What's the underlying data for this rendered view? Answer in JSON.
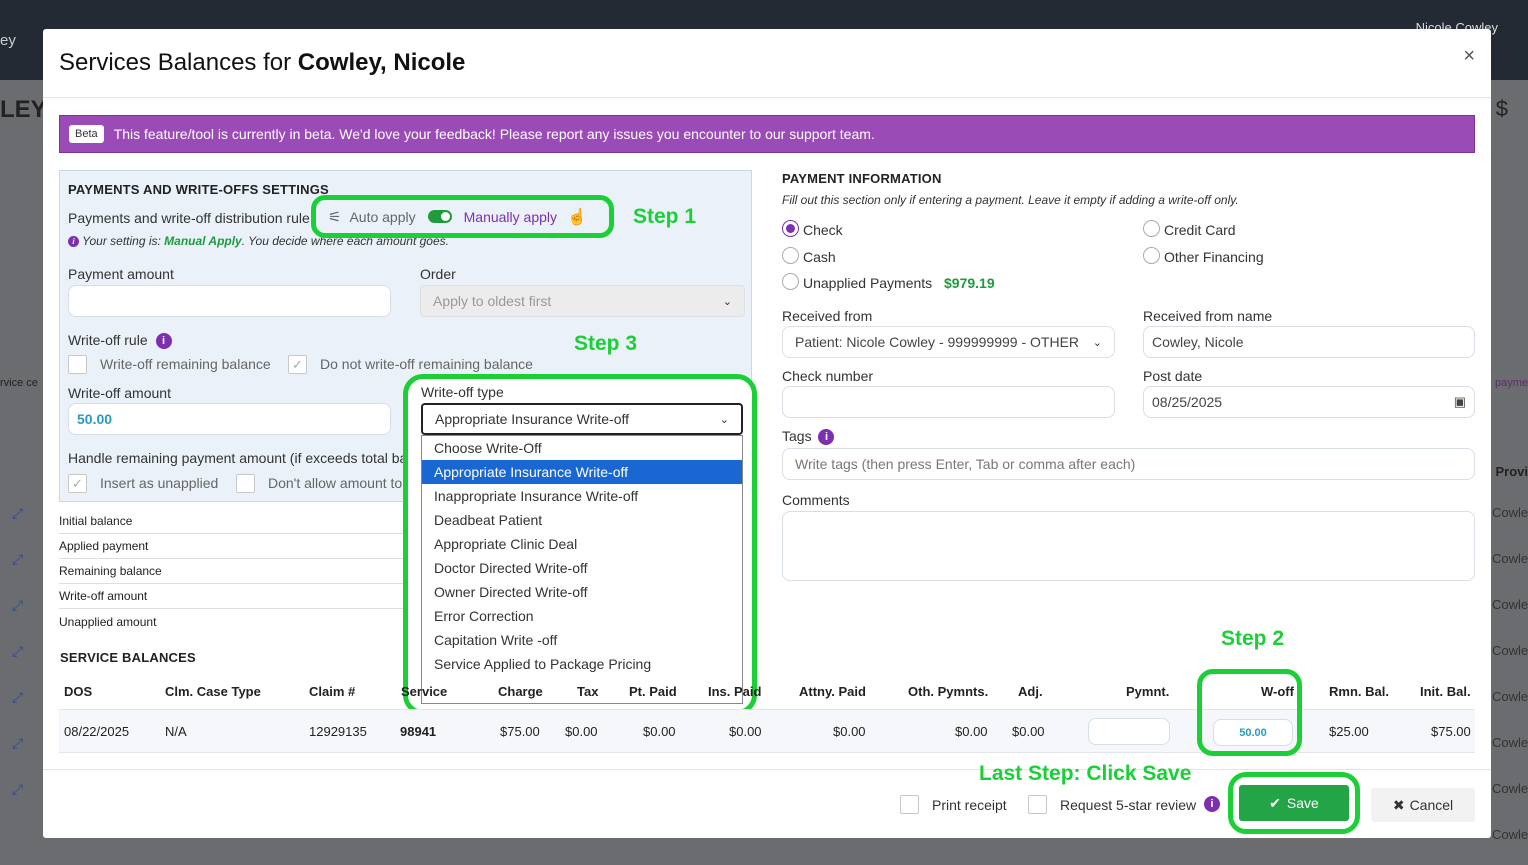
{
  "background": {
    "app_text_left": "ey",
    "user_name": "Nicole Cowley",
    "page_title_fragment": "LEY",
    "left_fragment": "rvice ce",
    "right_fragment": "payme",
    "provider_header": "Provi",
    "provider_rows": [
      "Cowle",
      "Cowle",
      "Cowle",
      "Cowle",
      "Cowle",
      "Cowle",
      "Cowle",
      "Cowle"
    ]
  },
  "modal": {
    "title_prefix": "Services Balances for ",
    "title_name": "Cowley, Nicole",
    "close": "×"
  },
  "beta": {
    "tag": "Beta",
    "message": "This feature/tool is currently in beta. We'd love your feedback! Please report any issues you encounter to our support team."
  },
  "settings": {
    "title": "PAYMENTS AND WRITE-OFFS SETTINGS",
    "distribution_label": "Payments and write-off distribution rule",
    "auto_apply": "Auto apply",
    "manual_apply": "Manually apply",
    "setting_note_prefix": "Your setting is: ",
    "setting_note_value": "Manual Apply",
    "setting_note_suffix": ". You decide where each amount goes.",
    "payment_amount_label": "Payment amount",
    "payment_amount_value": "",
    "order_label": "Order",
    "order_value": "Apply to oldest first",
    "writeoff_rule_label": "Write-off rule",
    "writeoff_remaining": "Write-off remaining balance",
    "no_writeoff_remaining": "Do not write-off remaining balance",
    "writeoff_amount_label": "Write-off amount",
    "writeoff_amount_value": "50.00",
    "writeoff_type_label": "Write-off type",
    "writeoff_type_value": "Appropriate Insurance Write-off",
    "handle_remaining_label": "Handle remaining payment amount (if exceeds total balance)",
    "insert_unapplied": "Insert as unapplied",
    "dont_allow": "Don't allow amount to exceed"
  },
  "writeoff_options": [
    "Choose Write-Off",
    "Appropriate Insurance Write-off",
    "Inappropriate Insurance Write-off",
    "Deadbeat Patient",
    "Appropriate Clinic Deal",
    "Doctor Directed Write-off",
    "Owner Directed Write-off",
    "Error Correction",
    "Capitation Write -off",
    "Service Applied to Package Pricing"
  ],
  "summary": {
    "rows": [
      "Initial balance",
      "Applied payment",
      "Remaining balance",
      "Write-off amount",
      "Unapplied amount"
    ]
  },
  "steps": {
    "step1": "Step 1",
    "step2": "Step 2",
    "step3": "Step 3",
    "last": "Last Step: Click Save"
  },
  "payment": {
    "title": "PAYMENT INFORMATION",
    "note": "Fill out this section only if entering a payment. Leave it empty if adding a write-off only.",
    "methods": {
      "check": "Check",
      "credit_card": "Credit Card",
      "cash": "Cash",
      "other_financing": "Other Financing",
      "unapplied": "Unapplied Payments",
      "unapplied_amount": "$979.19"
    },
    "received_from_label": "Received from",
    "received_from_value": "Patient: Nicole Cowley - 999999999 - OTHER",
    "received_from_name_label": "Received from name",
    "received_from_name_value": "Cowley, Nicole",
    "check_number_label": "Check number",
    "post_date_label": "Post date",
    "post_date_value": "08/25/2025",
    "tags_label": "Tags",
    "tags_placeholder": "Write tags (then press Enter, Tab or comma after each)",
    "comments_label": "Comments"
  },
  "service_balances": {
    "title": "SERVICE BALANCES",
    "columns": [
      "DOS",
      "Clm. Case Type",
      "Claim #",
      "Service",
      "Charge",
      "Tax",
      "Pt. Paid",
      "Ins. Paid",
      "Attny. Paid",
      "Oth. Pymnts.",
      "Adj.",
      "Pymnt.",
      "W-off",
      "Rmn. Bal.",
      "Init. Bal."
    ],
    "row": {
      "dos": "08/22/2025",
      "case_type": "N/A",
      "claim": "12929135",
      "service": "98941",
      "charge": "$75.00",
      "tax": "$0.00",
      "pt_paid": "$0.00",
      "ins_paid": "$0.00",
      "attny_paid": "$0.00",
      "oth_pymnts": "$0.00",
      "adj": "$0.00",
      "wo": "50.00",
      "rmn_bal": "$25.00",
      "init_bal": "$75.00"
    }
  },
  "footer": {
    "print_receipt": "Print receipt",
    "request_review": "Request 5-star review",
    "save": "Save",
    "cancel": "Cancel"
  },
  "colors": {
    "accent_purple": "#7d2fb0",
    "beta_purple": "#9b4bb5",
    "save_green": "#22a447",
    "highlight_green": "#1bcf36",
    "selected_blue": "#1967d2"
  }
}
